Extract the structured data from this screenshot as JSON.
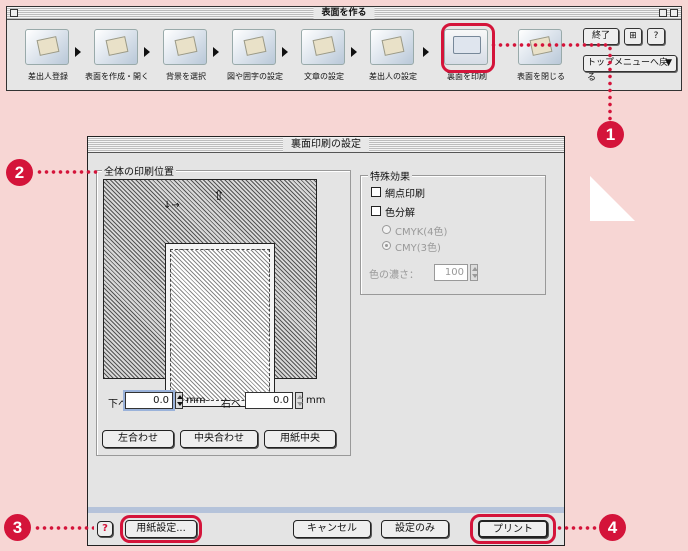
{
  "toolbar_window": {
    "title": "表面を作る",
    "steps": [
      {
        "label": "差出人登録"
      },
      {
        "label": "表面を作成・開く"
      },
      {
        "label": "背景を選択"
      },
      {
        "label": "図や囲字の設定"
      },
      {
        "label": "文章の設定"
      },
      {
        "label": "差出人の設定"
      },
      {
        "label": "裏面を印刷"
      },
      {
        "label": "表面を閉じる"
      }
    ],
    "end_button": "終了",
    "top_menu_button": "トップメニューへ戻る",
    "help_button": "?"
  },
  "dialog": {
    "title": "裏面印刷の設定",
    "position_group_label": "全体の印刷位置",
    "down_label": "下へ",
    "down_value": "0.0",
    "right_label": "右へ",
    "right_value": "0.0",
    "unit_mm": "mm",
    "align_buttons": [
      "左合わせ",
      "中央合わせ",
      "用紙中央"
    ],
    "effects_group_label": "特殊効果",
    "checkbox_halftone": "網点印刷",
    "checkbox_color_sep": "色分解",
    "radio_cmyk": "CMYK(4色)",
    "radio_cmy": "CMY(3色)",
    "density_label": "色の濃さ：",
    "density_value": "100",
    "help_button": "?",
    "paper_settings_button": "用紙設定...",
    "cancel_button": "キャンセル",
    "settings_only_button": "設定のみ",
    "print_button": "プリント"
  },
  "callouts": [
    "1",
    "2",
    "3",
    "4"
  ],
  "colors": {
    "background": "#f7d6d4",
    "accent": "#d4143a"
  }
}
